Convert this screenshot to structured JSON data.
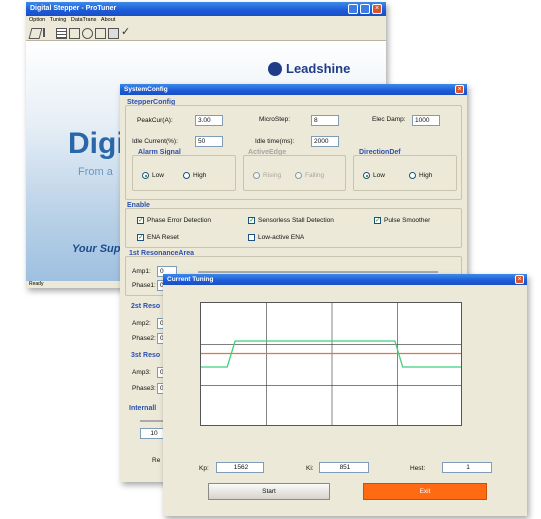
{
  "main_window": {
    "title": "Digital Stepper - ProTuner",
    "menu": [
      "Option",
      "Tuning",
      "DataTrans",
      "About"
    ],
    "brand": "Leadshine",
    "splash_big": "Digi",
    "splash_sub": "From a",
    "splash_slogan": "Your Supp",
    "status": "Ready"
  },
  "system_config": {
    "title": "SystemConfig",
    "stepper_config_heading": "StepperConfig",
    "peak_cur_label": "PeakCur(A):",
    "peak_cur_value": "3.00",
    "micro_step_label": "MicroStep:",
    "micro_step_value": "8",
    "elec_damp_label": "Elec Damp:",
    "elec_damp_value": "1000",
    "idle_current_label": "Idle Current(%):",
    "idle_current_value": "50",
    "idle_time_label": "Idle time(ms):",
    "idle_time_value": "2000",
    "alarm_signal_heading": "Alarm Signal",
    "alarm_low": "Low",
    "alarm_high": "High",
    "active_edge_heading": "ActiveEdge",
    "active_edge_rising": "Rising",
    "active_edge_falling": "Falling",
    "direction_heading": "DirectionDef",
    "direction_low": "Low",
    "direction_high": "High",
    "enable_heading": "Enable",
    "enable_items": [
      "Phase Error Detection",
      "Sensorless Stall Detection",
      "Pulse Smoother",
      "ENA Reset",
      "Low-active ENA"
    ],
    "enable_checked": [
      true,
      true,
      true,
      true,
      false
    ],
    "res1_heading": "1st ResonanceArea",
    "amp1_label": "Amp1:",
    "amp1_value": "0",
    "phase1_label": "Phase1:",
    "phase1_value": "0",
    "res2_heading": "2st Reso",
    "amp2_label": "Amp2:",
    "amp2_value": "0",
    "phase2_label": "Phase2:",
    "phase2_value": "0",
    "res3_heading": "3st Reso",
    "amp3_label": "Amp3:",
    "amp3_value": "0",
    "phase3_label": "Phase3:",
    "phase3_value": "0",
    "internal_heading": "Internall",
    "internal_value": "10",
    "re_label": "Re"
  },
  "current_tuning": {
    "title": "Current Tuning",
    "kp_label": "Kp:",
    "kp_value": "1562",
    "ki_label": "Ki:",
    "ki_value": "851",
    "hest_label": "Hest:",
    "hest_value": "1",
    "start_label": "Start",
    "exit_label": "Exit",
    "exit_color": "#ff6a13",
    "chart_data": {
      "type": "line",
      "title": "",
      "xlabel": "",
      "ylabel": "",
      "grid": true,
      "series": [
        {
          "color": "#e07a3a",
          "points": [
            [
              0,
              0.52
            ],
            [
              1,
              0.52
            ]
          ]
        },
        {
          "color": "#3fd07a",
          "points": [
            [
              0,
              0.0
            ],
            [
              0.1,
              0.0
            ],
            [
              0.13,
              1.0
            ],
            [
              0.74,
              1.0
            ],
            [
              0.77,
              0.0
            ],
            [
              1,
              0.0
            ]
          ]
        }
      ]
    }
  }
}
